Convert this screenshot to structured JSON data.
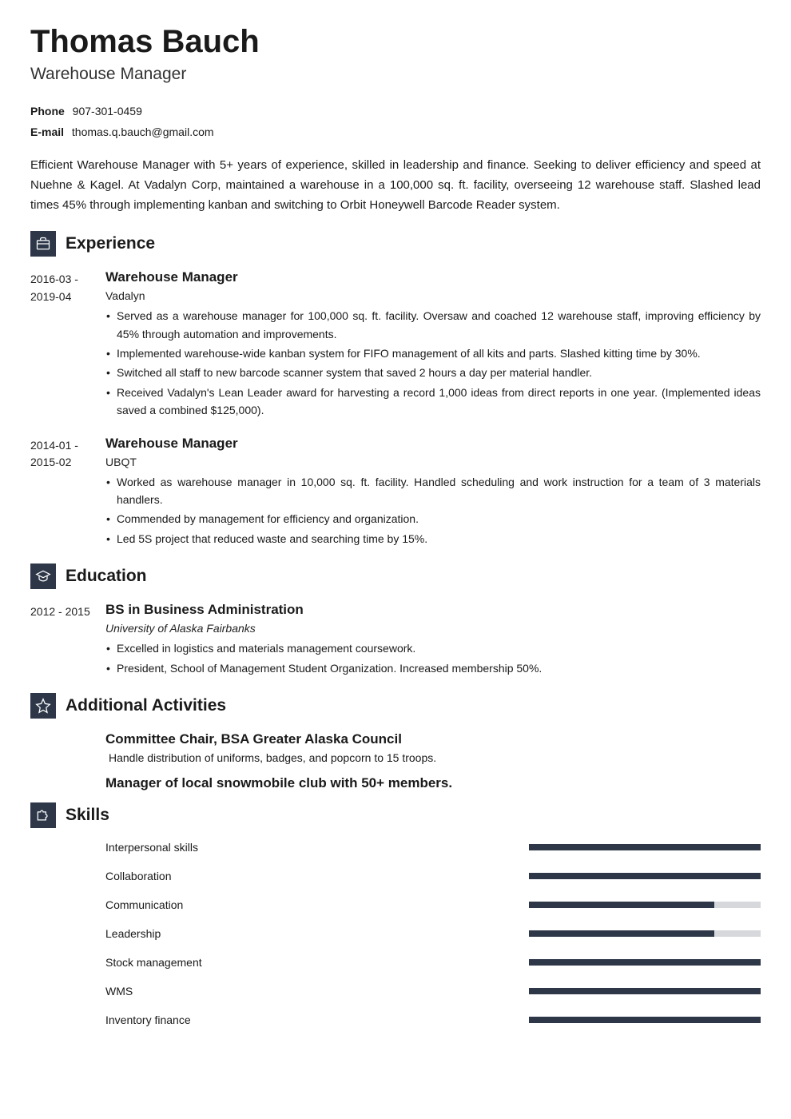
{
  "name": "Thomas Bauch",
  "title": "Warehouse Manager",
  "contact": {
    "phone_label": "Phone",
    "phone": "907-301-0459",
    "email_label": "E-mail",
    "email": "thomas.q.bauch@gmail.com"
  },
  "summary": "Efficient Warehouse Manager with 5+ years of experience, skilled in leadership and finance. Seeking to deliver efficiency and speed at Nuehne & Kagel. At Vadalyn Corp, maintained a warehouse in a 100,000 sq. ft. facility, overseeing 12 warehouse staff. Slashed lead times 45% through implementing kanban and switching to Orbit Honeywell Barcode Reader system.",
  "sections": {
    "experience_title": "Experience",
    "education_title": "Education",
    "activities_title": "Additional Activities",
    "skills_title": "Skills"
  },
  "experience": [
    {
      "dates": "2016-03 - 2019-04",
      "role": "Warehouse Manager",
      "company": "Vadalyn",
      "bullets": [
        "Served as a warehouse manager for 100,000 sq. ft. facility. Oversaw and coached 12 warehouse staff, improving efficiency by 45% through automation and improvements.",
        "Implemented warehouse-wide kanban system for FIFO management of all kits and parts. Slashed kitting time by 30%.",
        "Switched all staff to new barcode scanner system that saved 2 hours a day per material handler.",
        "Received Vadalyn's Lean Leader award for harvesting a record 1,000 ideas from direct reports in one year. (Implemented ideas saved a combined $125,000)."
      ]
    },
    {
      "dates": "2014-01 - 2015-02",
      "role": "Warehouse Manager",
      "company": "UBQT",
      "bullets": [
        "Worked as warehouse manager in 10,000 sq. ft. facility. Handled scheduling and work instruction for a team of 3 materials handlers.",
        "Commended by management for efficiency and organization.",
        "Led 5S project that reduced waste and searching time by 15%."
      ]
    }
  ],
  "education": [
    {
      "dates": "2012 - 2015",
      "degree": "BS in Business Administration",
      "school": "University of Alaska Fairbanks",
      "bullets": [
        "Excelled in logistics and materials management coursework.",
        "President, School of Management Student Organization. Increased membership 50%."
      ]
    }
  ],
  "activities": [
    {
      "title": "Committee Chair, BSA Greater Alaska Council",
      "desc": " Handle distribution of uniforms, badges, and popcorn to 15 troops."
    },
    {
      "title": "Manager of local snowmobile club with 50+ members.",
      "desc": ""
    }
  ],
  "skills": [
    {
      "name": "Interpersonal skills",
      "level": 100
    },
    {
      "name": "Collaboration",
      "level": 100
    },
    {
      "name": "Communication",
      "level": 80
    },
    {
      "name": "Leadership",
      "level": 80
    },
    {
      "name": "Stock management",
      "level": 100
    },
    {
      "name": "WMS",
      "level": 100
    },
    {
      "name": "Inventory finance",
      "level": 100
    }
  ]
}
